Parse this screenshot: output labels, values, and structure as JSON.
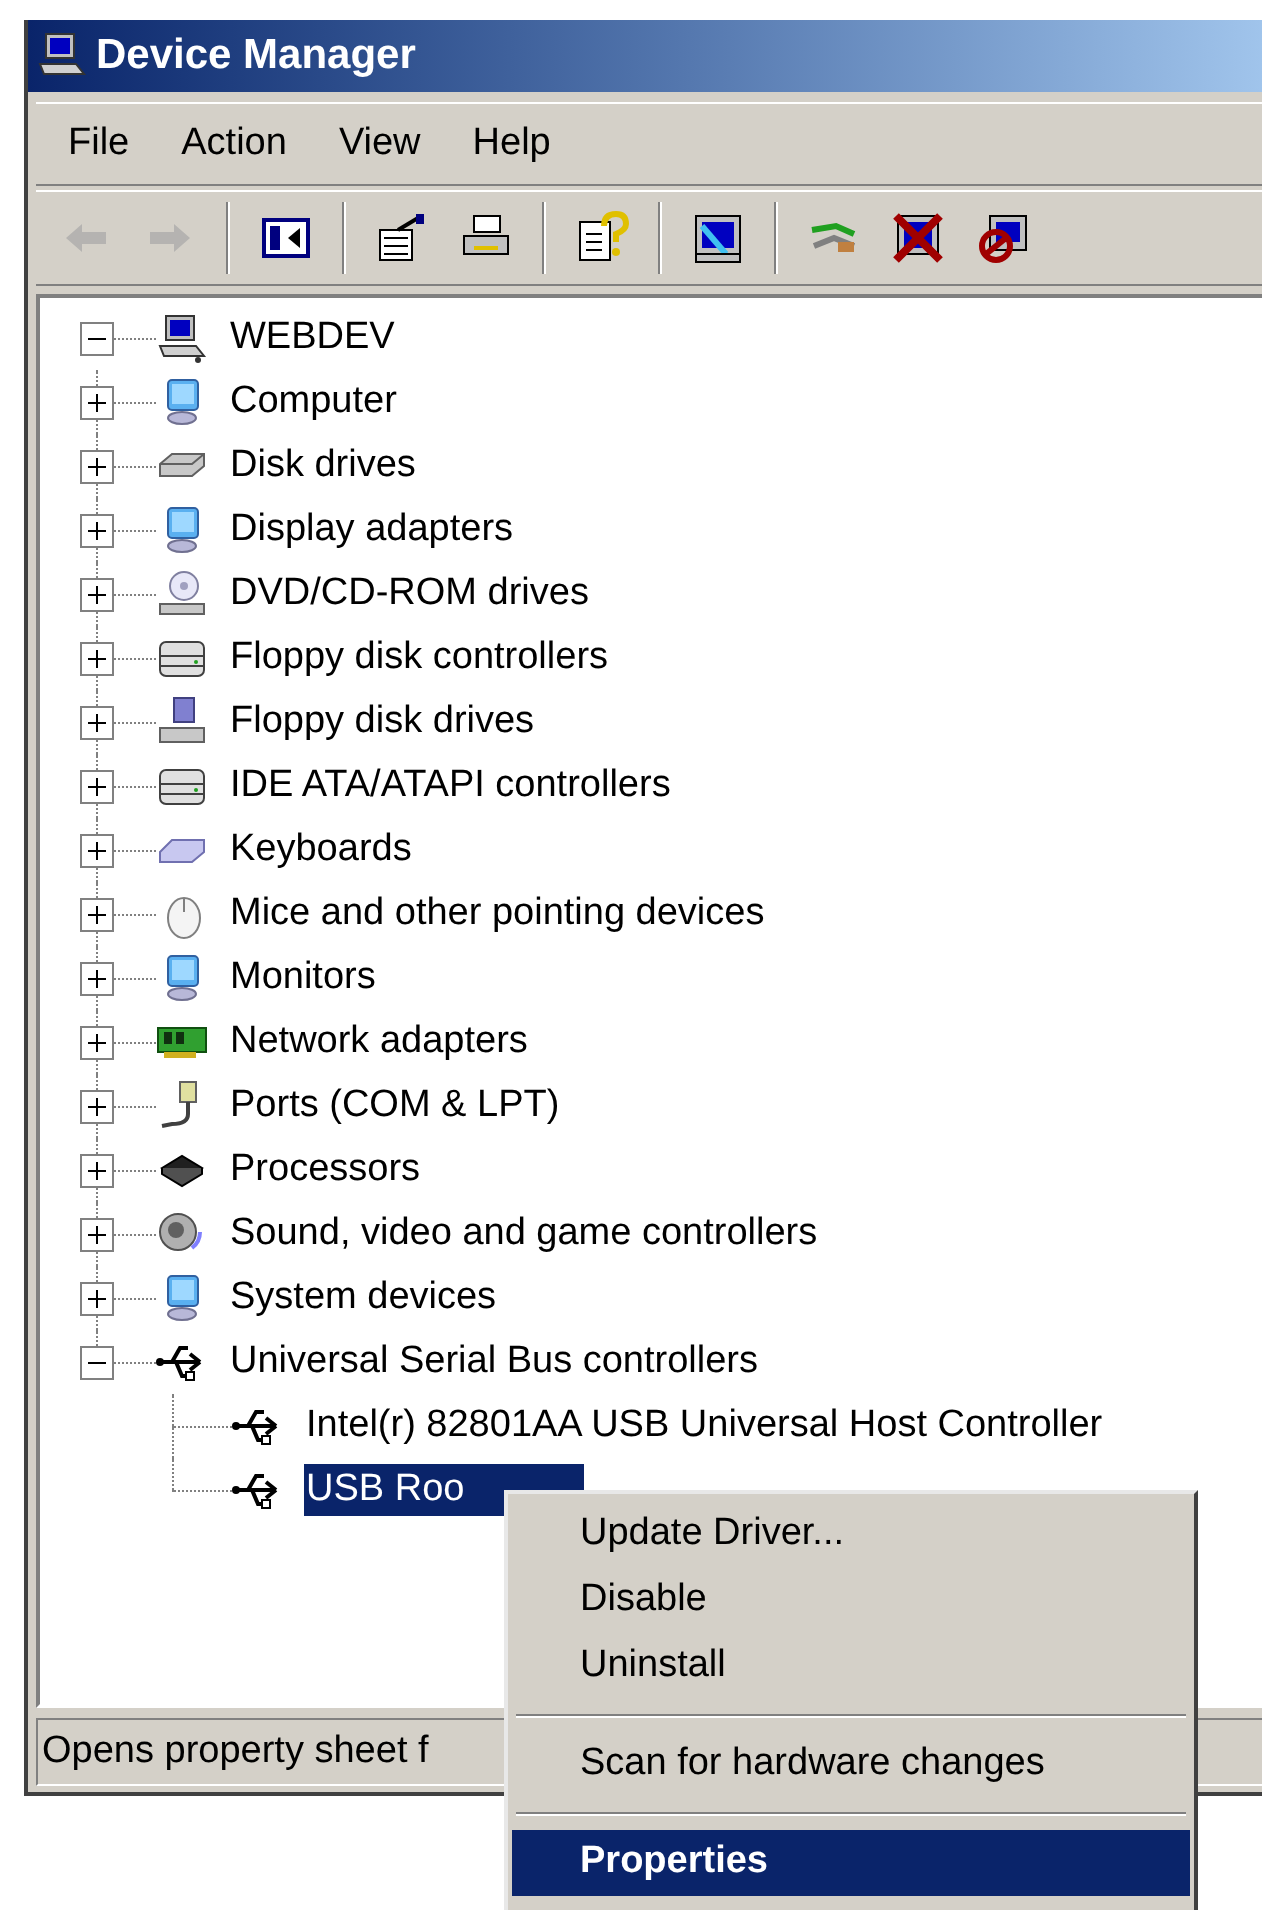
{
  "window": {
    "title": "Device Manager"
  },
  "menu_bar": [
    "File",
    "Action",
    "View",
    "Help"
  ],
  "toolbar": [
    {
      "kind": "back",
      "disabled": true
    },
    {
      "kind": "forward",
      "disabled": true
    },
    {
      "kind": "separator"
    },
    {
      "kind": "pane",
      "disabled": false
    },
    {
      "kind": "separator"
    },
    {
      "kind": "properties",
      "disabled": false
    },
    {
      "kind": "print",
      "disabled": false
    },
    {
      "kind": "separator"
    },
    {
      "kind": "help",
      "disabled": false
    },
    {
      "kind": "separator"
    },
    {
      "kind": "update",
      "disabled": false
    },
    {
      "kind": "separator"
    },
    {
      "kind": "scan",
      "disabled": false
    },
    {
      "kind": "uninstall",
      "disabled": false
    },
    {
      "kind": "disable",
      "disabled": false
    }
  ],
  "tree": [
    {
      "label": "WEBDEV",
      "kind": "computer",
      "expanded": true,
      "selected": false,
      "children": [
        {
          "label": "Computer",
          "kind": "monitor",
          "expanded": false,
          "selected": false
        },
        {
          "label": "Disk drives",
          "kind": "disk",
          "expanded": false,
          "selected": false
        },
        {
          "label": "Display adapters",
          "kind": "monitor",
          "expanded": false,
          "selected": false
        },
        {
          "label": "DVD/CD-ROM drives",
          "kind": "cd",
          "expanded": false,
          "selected": false
        },
        {
          "label": "Floppy disk controllers",
          "kind": "controller",
          "expanded": false,
          "selected": false
        },
        {
          "label": "Floppy disk drives",
          "kind": "floppy",
          "expanded": false,
          "selected": false
        },
        {
          "label": "IDE ATA/ATAPI controllers",
          "kind": "controller",
          "expanded": false,
          "selected": false
        },
        {
          "label": "Keyboards",
          "kind": "keyboard",
          "expanded": false,
          "selected": false
        },
        {
          "label": "Mice and other pointing devices",
          "kind": "mouse",
          "expanded": false,
          "selected": false
        },
        {
          "label": "Monitors",
          "kind": "monitor",
          "expanded": false,
          "selected": false
        },
        {
          "label": "Network adapters",
          "kind": "network",
          "expanded": false,
          "selected": false
        },
        {
          "label": "Ports (COM & LPT)",
          "kind": "port",
          "expanded": false,
          "selected": false
        },
        {
          "label": "Processors",
          "kind": "chip",
          "expanded": false,
          "selected": false
        },
        {
          "label": "Sound, video and game controllers",
          "kind": "speaker",
          "expanded": false,
          "selected": false
        },
        {
          "label": "System devices",
          "kind": "monitor",
          "expanded": false,
          "selected": false
        },
        {
          "label": "Universal Serial Bus controllers",
          "kind": "usb",
          "expanded": true,
          "selected": false,
          "children": [
            {
              "label": "Intel(r) 82801AA USB Universal Host Controller",
              "kind": "usb",
              "selected": false
            },
            {
              "label": "USB Roo",
              "kind": "usb",
              "selected": true
            }
          ]
        }
      ]
    }
  ],
  "context_menu": [
    {
      "kind": "item",
      "label": "Update Driver...",
      "selected": false,
      "default": false
    },
    {
      "kind": "item",
      "label": "Disable",
      "selected": false,
      "default": false
    },
    {
      "kind": "item",
      "label": "Uninstall",
      "selected": false,
      "default": false
    },
    {
      "kind": "separator"
    },
    {
      "kind": "item",
      "label": "Scan for hardware changes",
      "selected": false,
      "default": false
    },
    {
      "kind": "separator"
    },
    {
      "kind": "item",
      "label": "Properties",
      "selected": true,
      "default": true
    }
  ],
  "status_bar": "Opens property sheet f"
}
